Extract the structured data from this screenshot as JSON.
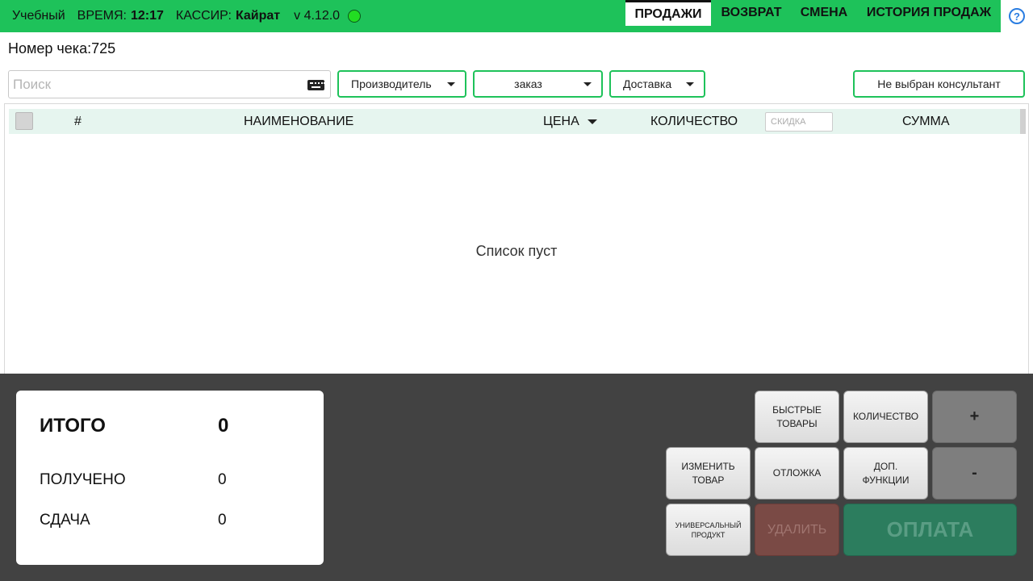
{
  "topbar": {
    "mode": "Учебный",
    "time_label": "ВРЕМЯ:",
    "time": "12:17",
    "cashier_label": "КАССИР:",
    "cashier": "Кайрат",
    "version": "v 4.12.0",
    "status_color": "#22dd22",
    "tabs": [
      "ПРОДАЖИ",
      "ВОЗВРАТ",
      "СМЕНА",
      "ИСТОРИЯ ПРОДАЖ"
    ],
    "active_tab": "ПРОДАЖИ",
    "help_icon": "?"
  },
  "receipt": {
    "label": "Номер чека:725"
  },
  "search": {
    "placeholder": "Поиск",
    "value": ""
  },
  "filters": {
    "manufacturer": "Производитель",
    "order": "заказ",
    "delivery": "Доставка",
    "consultant": "Не выбран консультант"
  },
  "table": {
    "columns": {
      "num": "#",
      "name": "НАИМЕНОВАНИЕ",
      "price": "ЦЕНА",
      "qty": "КОЛИЧЕСТВО",
      "discount_placeholder": "СКИДКА",
      "sum": "СУММА"
    },
    "rows": [],
    "empty_text": "Список пуст"
  },
  "totals": {
    "total_label": "ИТОГО",
    "total_value": "0",
    "received_label": "ПОЛУЧЕНО",
    "received_value": "0",
    "change_label": "СДАЧА",
    "change_value": "0"
  },
  "actions": {
    "quick_goods": [
      "БЫСТРЫЕ",
      "ТОВАРЫ"
    ],
    "quantity": "КОЛИЧЕСТВО",
    "plus": "+",
    "edit_item": [
      "ИЗМЕНИТЬ",
      "ТОВАР"
    ],
    "postpone": "ОТЛОЖКА",
    "extra_functions": [
      "ДОП.",
      "ФУНКЦИИ"
    ],
    "minus": "-",
    "universal_product": [
      "УНИВЕРСАЛЬНЫЙ",
      "ПРОДУКТ"
    ],
    "delete": "УДАЛИТЬ",
    "pay": "ОПЛАТА"
  },
  "colors": {
    "accent": "#1ec25a",
    "bottom_panel": "#424242",
    "pay": "#2c7d5e",
    "delete": "#7a4a45",
    "help": "#2a7de1"
  }
}
